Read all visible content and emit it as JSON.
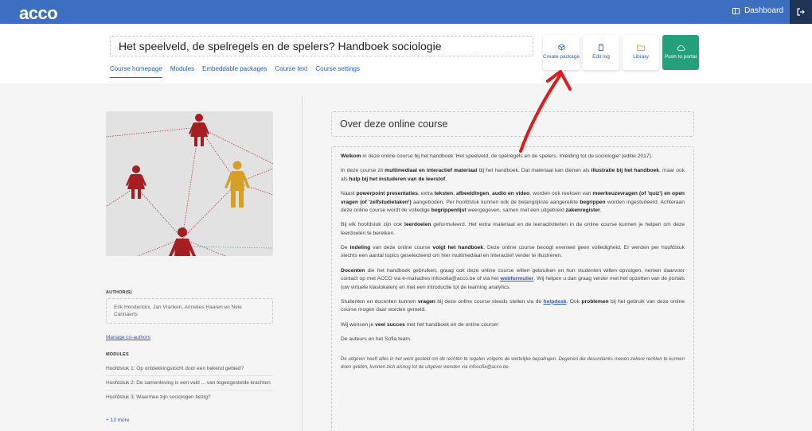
{
  "topbar": {
    "logo": "acco",
    "dashboard_label": "Dashboard",
    "logout_icon": "logout-icon"
  },
  "header": {
    "course_title": "Het speelveld, de spelregels en de spelers? Handboek sociologie",
    "tabs": [
      {
        "label": "Course homepage",
        "active": true
      },
      {
        "label": "Modules",
        "active": false
      },
      {
        "label": "Embeddable packages",
        "active": false
      },
      {
        "label": "Course text",
        "active": false
      },
      {
        "label": "Course settings",
        "active": false
      }
    ],
    "actions": {
      "create": "Create package",
      "editlog": "Edit log",
      "library": "Library",
      "push": "Push to portal"
    }
  },
  "sidebar": {
    "authors_label": "AUTHOR(S)",
    "authors": "Erik Henderickx, Jan Vranken, Annelies Haaren en Nele Cannaerts",
    "manage_label": "Manage co-authors",
    "modules_label": "MODULES",
    "modules": [
      "Hoofdstuk 1: Op ontdekkingstocht door een bekend gebied?",
      "Hoofdstuk 2: De samenleving is een veld ... van tegengestelde krachten",
      "Hoofdstuk 3: Waarmee zijn sociologen bezig?"
    ],
    "more_label": "+ 13 more"
  },
  "about": {
    "title": "Over deze online course",
    "p1": {
      "bold1": "Welkom",
      "text1": " in deze online course bij het handboek 'Het speelveld, de spelregels en de spelers. Inleiding tot de sociologie' (editie 2017)."
    },
    "p2": {
      "text1": "In deze course zit ",
      "bold1": "multimediaal en interactief materiaal",
      "text2": " bij het handboek. Dat materiaal kan dienen als ",
      "bold2": "illustratie bij het handboek",
      "text3": ", maar ook als ",
      "bold3": "hulp bij het instuderen van de leerstof",
      "text4": "."
    },
    "p3": {
      "text1": "Naast ",
      "bold1": "powerpoint presentaties",
      "text2": ", extra ",
      "bold2": "teksten",
      "text3": ", ",
      "bold3": "afbeeldingen",
      "text4": ", ",
      "bold4": "audio en video",
      "text5": ", worden ook reeksen van ",
      "bold5": "meerkeuzevragen (of 'quiz') en open vragen (of 'zelfstudietaken')",
      "text6": " aangeboden. Per hoofdstuk kunnen ook de belangrijkste aangereikte ",
      "bold6": "begrippen",
      "text7": " worden ingestudeerd. Achteraan deze online course wordt de volledige ",
      "bold7": "begrippenlijst",
      "text8": " weergegeven, samen met een uitgebreid ",
      "bold8": "zakenregister",
      "text9": "."
    },
    "p4": {
      "text1": "Bij elk hoofdstuk zijn ook ",
      "bold1": "leerdoelen",
      "text2": " geformuleerd. Het extra materiaal en de leeractiviteiten in de online course kunnen je helpen om deze leerdoelen te bereiken."
    },
    "p5": {
      "text1": "De ",
      "bold1": "indeling",
      "text2": " van deze online course ",
      "bold2": "volgt het handboek",
      "text3": ". Deze online course beoogt evenwel geen volledigheid. Er werden per hoofdstuk slechts een aantal topics geselecteerd om hier multimediaal en interactief verder te illustreren."
    },
    "p6": {
      "bold1": "Docenten",
      "text1": " die het handboek gebruiken, graag ook deze online course willen gebruiken en hun studenten willen opvolgen, nemen daarvoor contact op met ACCO via e-mailadres infosofia@acco.be of via het ",
      "link1": "webformulier",
      "text2": ". Wij helpen u dan graag verder met het opzetten van de portals (uw virtuele klaslokalen) en met een introductie tot de learning analytics."
    },
    "p7": {
      "text1": "Studenten en docenten kunnen ",
      "bold1": "vragen",
      "text2": " bij deze online course steeds stellen via de ",
      "link1": "helpdesk",
      "text3": ". Ook ",
      "bold2": "problemen",
      "text4": " bij het gebruik van deze online course mogen daar worden gemeld."
    },
    "p8": {
      "text1": "Wij wensen je ",
      "bold1": "veel succes",
      "text2": " met het handboek en de online course!"
    },
    "p9": "De auteurs en het Sofia team.",
    "note": "De uitgever heeft alles in het werk gesteld om de rechten te regelen volgens de wettelijke bepalingen. Degenen die desondanks menen zekere rechten te kunnen doen gelden, kunnen zich alsnog tot de uitgever wenden via infosofia@acco.be."
  },
  "colors": {
    "brand_blue": "#3d6fc1",
    "push_green": "#24a07a",
    "figure_red": "#a51f22",
    "figure_gold": "#d4a029",
    "annotation_red": "#e01b1b"
  }
}
